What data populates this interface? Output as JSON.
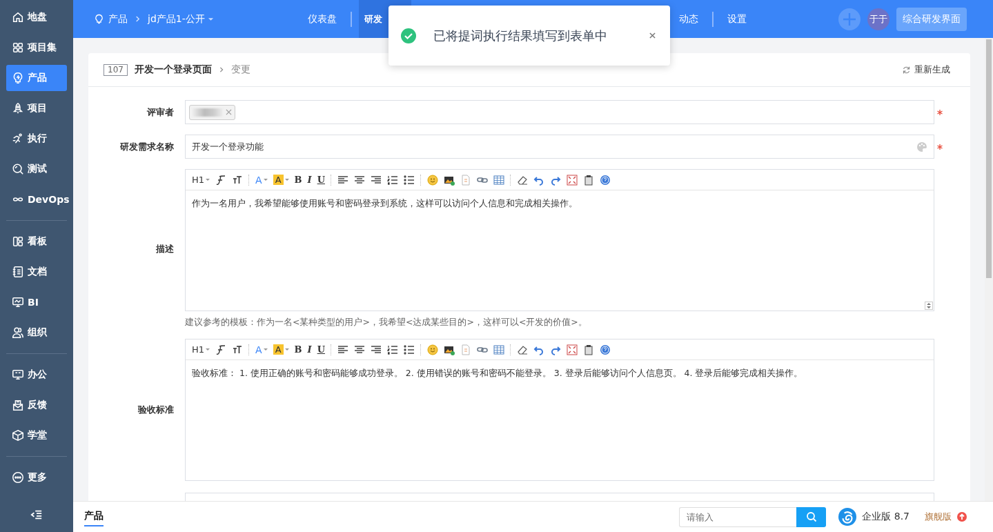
{
  "sidebar": {
    "groups": [
      {
        "items": [
          {
            "label": "地盘",
            "selected": false
          },
          {
            "label": "项目集",
            "selected": false
          },
          {
            "label": "产品",
            "selected": true
          },
          {
            "label": "项目",
            "selected": false
          },
          {
            "label": "执行",
            "selected": false
          },
          {
            "label": "测试",
            "selected": false
          },
          {
            "label": "DevOps",
            "selected": false
          }
        ]
      },
      {
        "items": [
          {
            "label": "看板",
            "selected": false
          },
          {
            "label": "文档",
            "selected": false
          },
          {
            "label": "BI",
            "selected": false
          },
          {
            "label": "组织",
            "selected": false
          }
        ]
      },
      {
        "items": [
          {
            "label": "办公",
            "selected": false
          },
          {
            "label": "反馈",
            "selected": false
          },
          {
            "label": "学堂",
            "selected": false
          }
        ]
      },
      {
        "items": [
          {
            "label": "更多",
            "selected": false
          }
        ]
      }
    ]
  },
  "topbar": {
    "breadcrumb": [
      "产品",
      "jd产品1-公开"
    ],
    "nav": [
      {
        "label": "仪表盘",
        "selected": false
      },
      {
        "label": "研发",
        "selected": true
      },
      {
        "label": "动态",
        "selected": false
      },
      {
        "label": "设置",
        "selected": false
      }
    ],
    "avatar": "于于",
    "switch_button": "综合研发界面"
  },
  "toast": {
    "message": "已将提词执行结果填写到表单中"
  },
  "card": {
    "id": "107",
    "title": "开发一个登录页面",
    "action": "变更",
    "regenerate": "重新生成",
    "fields": [
      {
        "kind": "tags",
        "label": "评审者",
        "required": true
      },
      {
        "kind": "text",
        "label": "研发需求名称",
        "value": "开发一个登录功能",
        "required": true
      },
      {
        "kind": "editor",
        "label": "描述",
        "toolbar": [
          "H1",
          "A",
          "A",
          "B",
          "I",
          "U"
        ],
        "content": "作为一名用户，我希望能够使用账号和密码登录到系统，这样可以访问个人信息和完成相关操作。",
        "hint": "建议参考的模板：作为一名<某种类型的用户>，我希望<达成某些目的>，这样可以<开发的价值>。"
      },
      {
        "kind": "editor",
        "label": "验收标准",
        "toolbar": [
          "H1",
          "A",
          "A",
          "B",
          "I",
          "U"
        ],
        "content": "验收标准： 1. 使用正确的账号和密码能够成功登录。 2. 使用错误的账号和密码不能登录。 3. 登录后能够访问个人信息页。 4. 登录后能够完成相关操作。"
      }
    ]
  },
  "footer": {
    "tabs": [
      {
        "label": "产品",
        "selected": true
      }
    ],
    "search": {
      "placeholder": "请输入"
    },
    "edition": "企业版 8.7",
    "upgrade": "旗舰版"
  }
}
